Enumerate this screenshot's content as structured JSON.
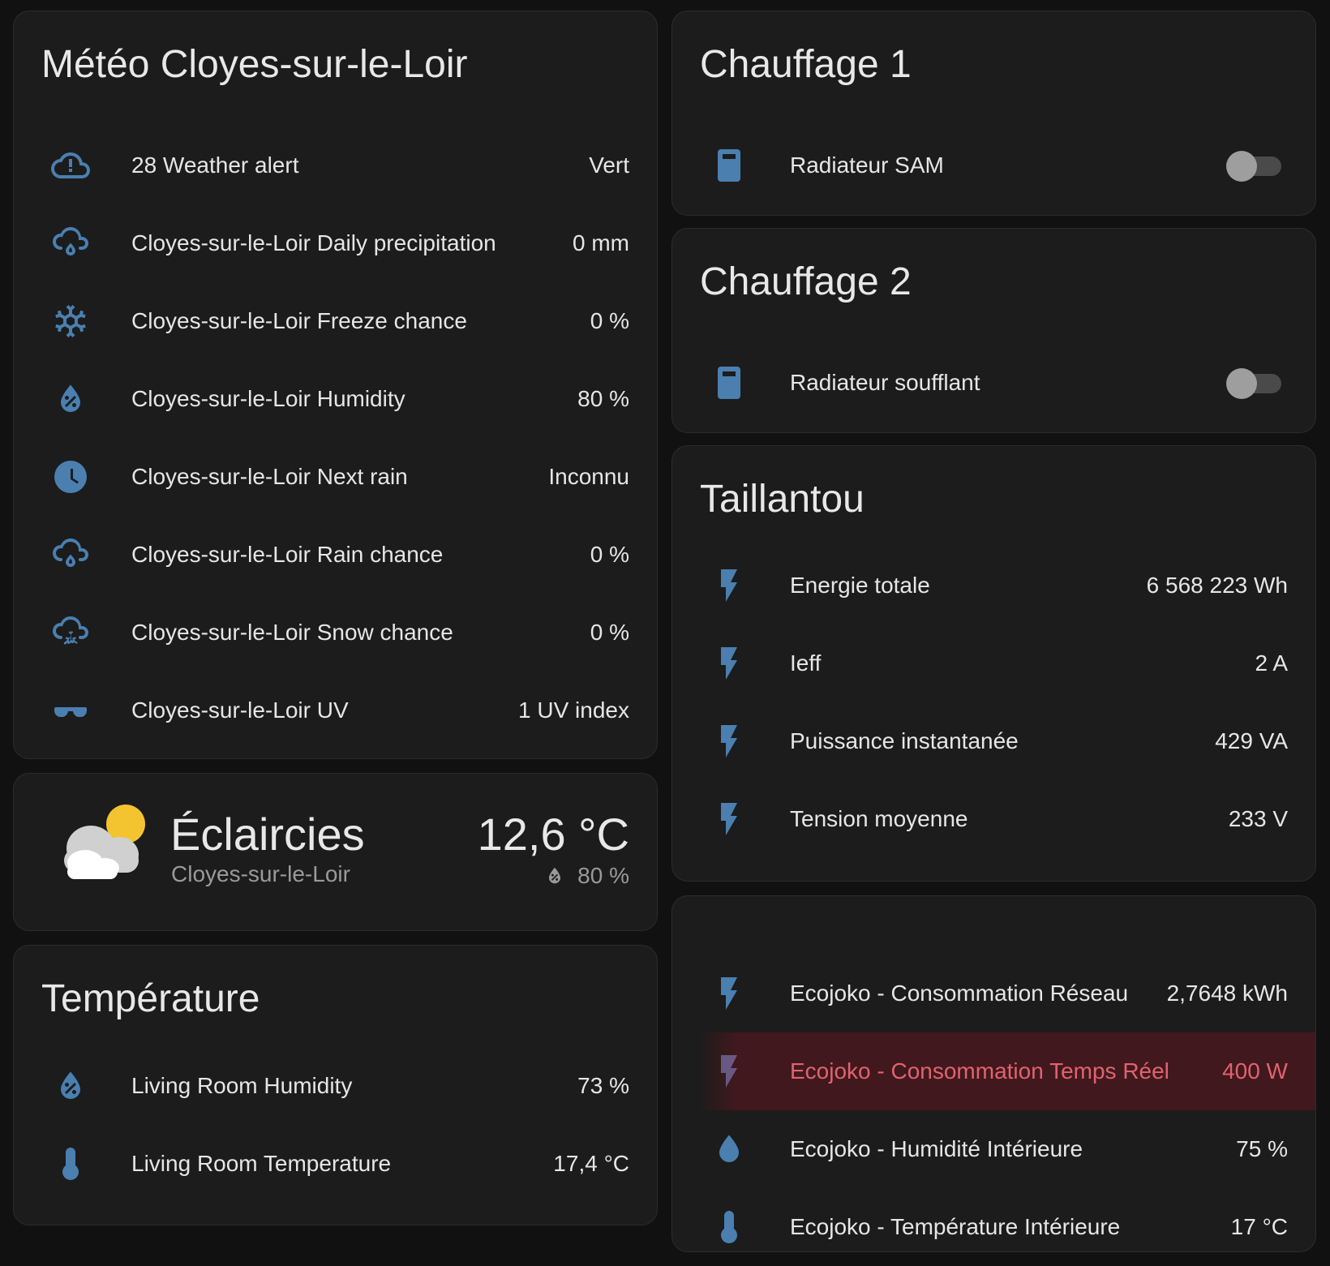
{
  "colors": {
    "background": "#111111",
    "card": "#1c1c1c",
    "icon": "#4a7fb0",
    "alert_text": "#e0636f",
    "sun": "#f4c430"
  },
  "meteo": {
    "title": "Météo Cloyes-sur-le-Loir",
    "rows": [
      {
        "icon": "cloud-alert-icon",
        "label": "28 Weather alert",
        "value": "Vert"
      },
      {
        "icon": "cloud-rain-icon",
        "label": "Cloyes-sur-le-Loir Daily precipitation",
        "value": "0 mm"
      },
      {
        "icon": "snowflake-icon",
        "label": "Cloyes-sur-le-Loir Freeze chance",
        "value": "0 %"
      },
      {
        "icon": "water-percent-icon",
        "label": "Cloyes-sur-le-Loir Humidity",
        "value": "80 %"
      },
      {
        "icon": "clock-icon",
        "label": "Cloyes-sur-le-Loir Next rain",
        "value": "Inconnu"
      },
      {
        "icon": "cloud-rain-icon",
        "label": "Cloyes-sur-le-Loir Rain chance",
        "value": "0 %"
      },
      {
        "icon": "cloud-snow-icon",
        "label": "Cloyes-sur-le-Loir Snow chance",
        "value": "0 %"
      },
      {
        "icon": "sunglasses-icon",
        "label": "Cloyes-sur-le-Loir UV",
        "value": "1 UV index"
      }
    ]
  },
  "forecast": {
    "condition": "Éclaircies",
    "location": "Cloyes-sur-le-Loir",
    "temperature": "12,6 °C",
    "humidity": "80 %",
    "icon": "partly-cloudy-icon"
  },
  "temperature_card": {
    "title": "Température",
    "rows": [
      {
        "icon": "water-percent-icon",
        "label": "Living Room Humidity",
        "value": "73 %"
      },
      {
        "icon": "thermometer-icon",
        "label": "Living Room Temperature",
        "value": "17,4 °C"
      }
    ]
  },
  "chauffage1": {
    "title": "Chauffage 1",
    "device": "Radiateur SAM",
    "state": "off",
    "icon": "radiator-icon"
  },
  "chauffage2": {
    "title": "Chauffage 2",
    "device": "Radiateur soufflant",
    "state": "off",
    "icon": "radiator-icon"
  },
  "taillantou": {
    "title": "Taillantou",
    "rows": [
      {
        "icon": "flash-icon",
        "label": "Energie totale",
        "value": "6 568 223 Wh"
      },
      {
        "icon": "flash-icon",
        "label": "Ieff",
        "value": "2 A"
      },
      {
        "icon": "flash-icon",
        "label": "Puissance instantanée",
        "value": "429 VA"
      },
      {
        "icon": "flash-icon",
        "label": "Tension moyenne",
        "value": "233 V"
      }
    ]
  },
  "ecojoko": {
    "rows": [
      {
        "icon": "flash-icon",
        "label": "Ecojoko - Consommation Réseau",
        "value": "2,7648 kWh"
      },
      {
        "icon": "flash-icon",
        "label": "Ecojoko - Consommation Temps Réel",
        "value": "400 W"
      },
      {
        "icon": "water-icon",
        "label": "Ecojoko - Humidité Intérieure",
        "value": "75 %"
      },
      {
        "icon": "thermometer-icon",
        "label": "Ecojoko - Température Intérieure",
        "value": "17 °C"
      }
    ]
  }
}
